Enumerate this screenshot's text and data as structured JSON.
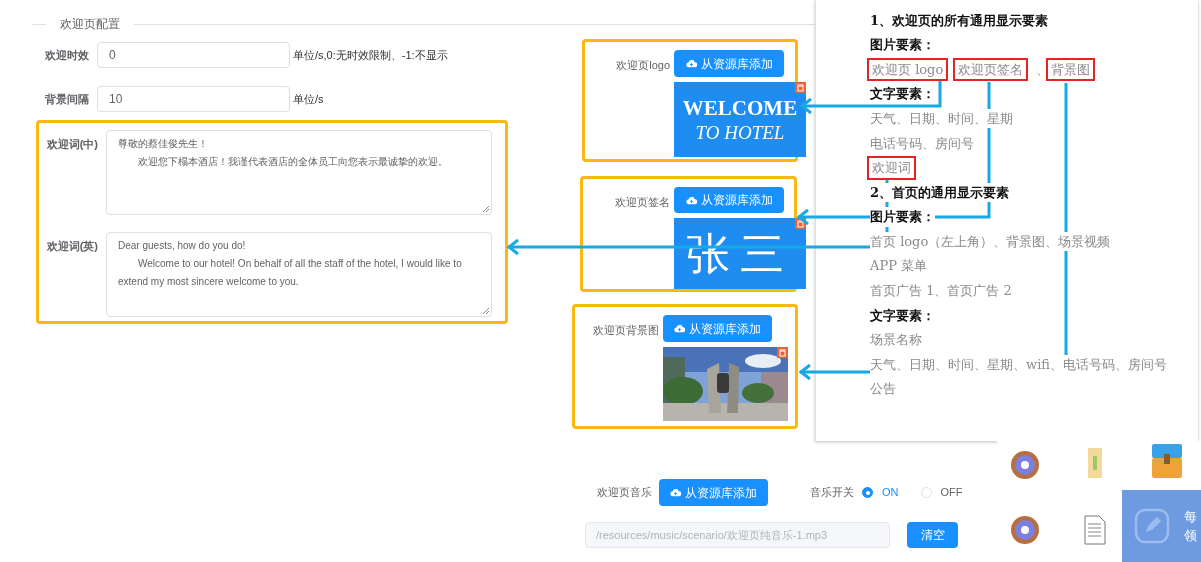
{
  "section_title": "欢迎页配置",
  "fields": [
    {
      "label": "欢迎时效",
      "value": "0",
      "hint": "单位/s,0:无时效限制、-1:不显示"
    },
    {
      "label": "背景间隔",
      "value": "10",
      "hint": "单位/s"
    }
  ],
  "greetings": [
    {
      "label": "欢迎词(中)",
      "lines": [
        "尊敬的蔡佳俊先生！",
        "欢迎您下榻本酒店！我谨代表酒店的全体员工向您表示最诚挚的欢迎。"
      ]
    },
    {
      "label": "欢迎词(英)",
      "lines": [
        "Dear guests, how do you do!",
        "Welcome to our hotel! On behalf of all the staff of the hotel, I would like to extend my most sincere welcome to you."
      ]
    }
  ],
  "media": [
    {
      "label": "欢迎页logo",
      "button": "从资源库添加",
      "kind": "logo",
      "lines": [
        "WELCOME",
        "TO HOTEL"
      ]
    },
    {
      "label": "欢迎页签名",
      "button": "从资源库添加",
      "kind": "signature",
      "lines": [
        "张三"
      ]
    },
    {
      "label": "欢迎页背景图",
      "button": "从资源库添加",
      "kind": "picture"
    }
  ],
  "music": {
    "label": "欢迎页音乐",
    "button": "从资源库添加",
    "switch_label": "音乐开关",
    "options": [
      {
        "label": "ON",
        "selected": true
      },
      {
        "label": "OFF",
        "selected": false
      }
    ],
    "path": "/resources/music/scenario/欢迎页纯音乐-1.mp3",
    "clear_button": "清空"
  },
  "doc": {
    "lines": [
      {
        "kind": "heading",
        "parts": [
          {
            "text": "1、欢迎页的所有通用显示要素",
            "boxed": false
          }
        ]
      },
      {
        "kind": "heading",
        "parts": [
          {
            "text": "图片要素：",
            "boxed": false
          }
        ]
      },
      {
        "kind": "item",
        "parts": [
          {
            "text": "欢迎页 logo",
            "boxed": true
          },
          {
            "text": "欢迎页签名",
            "boxed": true
          },
          {
            "text": "、",
            "boxed": false
          },
          {
            "text": "背景图",
            "boxed": true
          }
        ]
      },
      {
        "kind": "heading",
        "parts": [
          {
            "text": "文字要素：",
            "boxed": false
          }
        ]
      },
      {
        "kind": "item",
        "parts": [
          {
            "text": "天气、日期、时间、星期",
            "boxed": false
          }
        ]
      },
      {
        "kind": "item",
        "parts": [
          {
            "text": "电话号码、房间号",
            "boxed": false
          }
        ]
      },
      {
        "kind": "item",
        "parts": [
          {
            "text": "欢迎词",
            "boxed": true
          }
        ]
      },
      {
        "kind": "heading",
        "parts": [
          {
            "text": "2、首页的通用显示要素",
            "boxed": false
          }
        ]
      },
      {
        "kind": "heading",
        "parts": [
          {
            "text": "图片要素：",
            "boxed": false
          }
        ]
      },
      {
        "kind": "item",
        "parts": [
          {
            "text": "首页 logo（左上角）、背景图、场景视频",
            "boxed": false
          }
        ]
      },
      {
        "kind": "item",
        "parts": [
          {
            "text": "APP 菜单",
            "boxed": false
          }
        ]
      },
      {
        "kind": "item",
        "parts": [
          {
            "text": "首页广告 1、首页广告 2",
            "boxed": false
          }
        ]
      },
      {
        "kind": "heading",
        "parts": [
          {
            "text": "文字要素：",
            "boxed": false
          }
        ]
      },
      {
        "kind": "item",
        "parts": [
          {
            "text": "场景名称",
            "boxed": false
          }
        ]
      },
      {
        "kind": "item",
        "parts": [
          {
            "text": "天气、日期、时间、星期、wifi、电话号码、房间号",
            "boxed": false
          }
        ]
      },
      {
        "kind": "item",
        "parts": [
          {
            "text": "公告",
            "boxed": false
          }
        ]
      }
    ]
  },
  "desktop_widget": {
    "lines": [
      "每",
      "领"
    ]
  }
}
